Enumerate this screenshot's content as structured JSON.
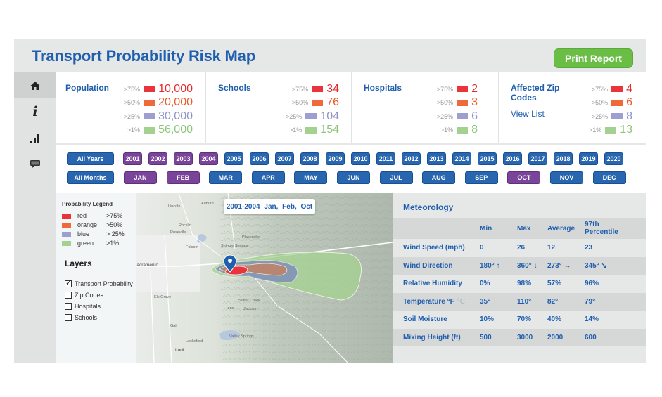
{
  "header": {
    "title": "Transport Probability Risk Map",
    "print_label": "Print Report"
  },
  "sidebar": {
    "items": [
      {
        "icon": "home-icon",
        "active": true
      },
      {
        "icon": "info-icon",
        "active": false
      },
      {
        "icon": "bar-chart-icon",
        "active": false
      },
      {
        "icon": "chat-icon",
        "active": false
      }
    ]
  },
  "colors": {
    "accent": "#1f5fae",
    "print_button": "#6abd45",
    "red": "#e8343a",
    "orange": "#ef6a3a",
    "blue": "#9c9fd0",
    "green": "#a4d18f",
    "selected_filter": "#7a449a",
    "filter": "#2866b0"
  },
  "stats": [
    {
      "title": "Population",
      "rows": [
        {
          "pct": ">75%",
          "value": "10,000"
        },
        {
          "pct": ">50%",
          "value": "20,000"
        },
        {
          "pct": ">25%",
          "value": "30,000"
        },
        {
          "pct": ">1%",
          "value": "56,000"
        }
      ]
    },
    {
      "title": "Schools",
      "rows": [
        {
          "pct": ">75%",
          "value": "34"
        },
        {
          "pct": ">50%",
          "value": "76"
        },
        {
          "pct": ">25%",
          "value": "104"
        },
        {
          "pct": ">1%",
          "value": "154"
        }
      ]
    },
    {
      "title": "Hospitals",
      "rows": [
        {
          "pct": ">75%",
          "value": "2"
        },
        {
          "pct": ">50%",
          "value": "3"
        },
        {
          "pct": ">25%",
          "value": "6"
        },
        {
          "pct": ">1%",
          "value": "8"
        }
      ]
    },
    {
      "title": "Affected Zip Codes",
      "link": "View List",
      "rows": [
        {
          "pct": ">75%",
          "value": "4"
        },
        {
          "pct": ">50%",
          "value": "6"
        },
        {
          "pct": ">25%",
          "value": "8"
        },
        {
          "pct": ">1%",
          "value": "13"
        }
      ]
    }
  ],
  "filters": {
    "all_years": "All Years",
    "all_months": "All Months",
    "years": [
      {
        "label": "2001",
        "selected": true
      },
      {
        "label": "2002",
        "selected": true
      },
      {
        "label": "2003",
        "selected": true
      },
      {
        "label": "2004",
        "selected": true
      },
      {
        "label": "2005",
        "selected": false
      },
      {
        "label": "2006",
        "selected": false
      },
      {
        "label": "2007",
        "selected": false
      },
      {
        "label": "2008",
        "selected": false
      },
      {
        "label": "2009",
        "selected": false
      },
      {
        "label": "2010",
        "selected": false
      },
      {
        "label": "2011",
        "selected": false
      },
      {
        "label": "2012",
        "selected": false
      },
      {
        "label": "2013",
        "selected": false
      },
      {
        "label": "2014",
        "selected": false
      },
      {
        "label": "2015",
        "selected": false
      },
      {
        "label": "2016",
        "selected": false
      },
      {
        "label": "2017",
        "selected": false
      },
      {
        "label": "2018",
        "selected": false
      },
      {
        "label": "2019",
        "selected": false
      },
      {
        "label": "2020",
        "selected": false
      }
    ],
    "months": [
      {
        "label": "JAN",
        "selected": true
      },
      {
        "label": "FEB",
        "selected": true
      },
      {
        "label": "MAR",
        "selected": false
      },
      {
        "label": "APR",
        "selected": false
      },
      {
        "label": "MAY",
        "selected": false
      },
      {
        "label": "JUN",
        "selected": false
      },
      {
        "label": "JUL",
        "selected": false
      },
      {
        "label": "AUG",
        "selected": false
      },
      {
        "label": "SEP",
        "selected": false
      },
      {
        "label": "OCT",
        "selected": true
      },
      {
        "label": "NOV",
        "selected": false
      },
      {
        "label": "DEC",
        "selected": false
      }
    ]
  },
  "legend": {
    "title": "Probability Legend",
    "items": [
      {
        "name": "red",
        "range": ">75%"
      },
      {
        "name": "orange",
        "range": ">50%"
      },
      {
        "name": "blue",
        "range": "> 25%"
      },
      {
        "name": "green",
        "range": ">1%"
      }
    ]
  },
  "layers": {
    "title": "Layers",
    "items": [
      {
        "label": "Transport Probability",
        "checked": true
      },
      {
        "label": "Zip Codes",
        "checked": false
      },
      {
        "label": "Hospitals",
        "checked": false
      },
      {
        "label": "Schools",
        "checked": false
      }
    ]
  },
  "map": {
    "badge": "2001-2004  Jan, Feb, Oct",
    "places": [
      "Lincoln",
      "Auburn",
      "Rocklin",
      "Roseville",
      "Folsom",
      "Sacramento",
      "Elk Grove",
      "Galt",
      "Lockeford",
      "Lodi",
      "Sutter Creek",
      "Ione",
      "Jackson",
      "Valley Springs",
      "Shingle Springs",
      "Placerville"
    ]
  },
  "meteorology": {
    "title": "Meteorology",
    "columns": [
      "",
      "Min",
      "Max",
      "Average",
      "97th Percentile"
    ],
    "rows": [
      {
        "label": "Wind Speed (mph)",
        "values": [
          "0",
          "26",
          "12",
          "23"
        ]
      },
      {
        "label": "Wind Direction",
        "values": [
          "180° ↑",
          "360° ↓",
          "273° →",
          "345° ↘"
        ]
      },
      {
        "label": "Relative Humidity",
        "values": [
          "0%",
          "98%",
          "57%",
          "96%"
        ]
      },
      {
        "label": "Temperature °F",
        "unit_alt": "°C",
        "values": [
          "35°",
          "110°",
          "82°",
          "79°"
        ]
      },
      {
        "label": "Soil Moisture",
        "values": [
          "10%",
          "70%",
          "40%",
          "14%"
        ]
      },
      {
        "label": "Mixing Height (ft)",
        "values": [
          "500",
          "3000",
          "2000",
          "600"
        ]
      }
    ]
  }
}
